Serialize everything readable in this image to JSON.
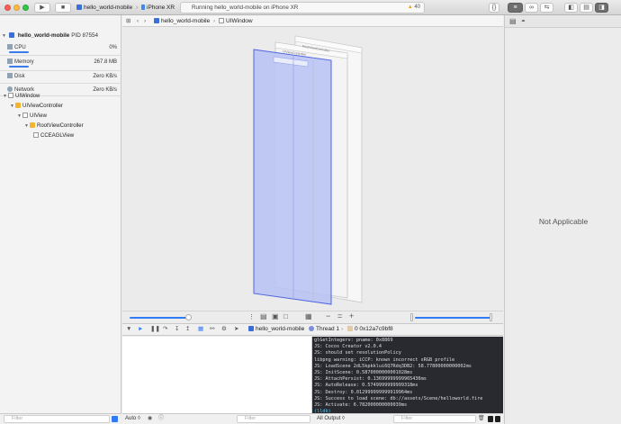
{
  "toolbar": {
    "scheme_name": "hello_world-mobile",
    "device_name": "iPhone XR",
    "status_text": "Running hello_world-mobile on iPhone XR",
    "warning_count": "40"
  },
  "navigator": {
    "process_name": "hello_world-mobile",
    "pid": "PID 87554",
    "gauges": [
      {
        "label": "CPU",
        "value": "0%",
        "fill": 0.0
      },
      {
        "label": "Memory",
        "value": "267.8 MB",
        "fill": 0.5
      },
      {
        "label": "Disk",
        "value": "Zero KB/s"
      },
      {
        "label": "Network",
        "value": "Zero KB/s"
      }
    ],
    "tree": [
      {
        "label": "UIWindow",
        "level": 0
      },
      {
        "label": "UIViewController",
        "level": 1
      },
      {
        "label": "UIView",
        "level": 2
      },
      {
        "label": "RootViewController",
        "level": 3
      },
      {
        "label": "CCEAGLView",
        "level": 4
      }
    ],
    "filter_placeholder": "Filter"
  },
  "jumpbar": {
    "project": "hello_world-mobile",
    "selected": "UIWindow"
  },
  "canvas": {
    "layer_labels": [
      "RootViewController",
      "UIViewController"
    ]
  },
  "debug_bar": {
    "scheme_name": "hello_world-mobile",
    "thread": "Thread 1",
    "frame": "0 0x12a7c9bf8"
  },
  "variables": {
    "auto_label": "Auto ◊",
    "filter_placeholder": "Filter"
  },
  "console": {
    "lines": [
      "glGetIntegerv: pname: 0x8869",
      "JS: Cocos Creator v2.0.4",
      "JS: should set resolutionPolicy",
      "libpng warning: iCCP: known incorrect sRGB profile",
      "JS: LoadScene 2dL5kpkklui6Q7Rdq3DB2: 58.77800000000002ms",
      "JS: InitScene: 0.5870000000001028ms",
      "JS: AttachPersist: 0.13699999999965436ms",
      "JS: AutoRelease: 0.5749999999999318ms",
      "JS: Destroy: 0.012999999999919964ms",
      "JS: Success to load scene: db://assets/Scene/helloworld.fire",
      "JS: Activate: 6.782000000000039ms"
    ],
    "prompt": "(lldb)",
    "output_select": "All Output ◊",
    "filter_placeholder": "Filter"
  },
  "inspector": {
    "empty_label": "Not Applicable"
  },
  "colors": {
    "accent": "#2f7bf5",
    "window_fill": "#b7c2f4",
    "window_border": "#4f65e0",
    "console_bg": "#292a30"
  }
}
